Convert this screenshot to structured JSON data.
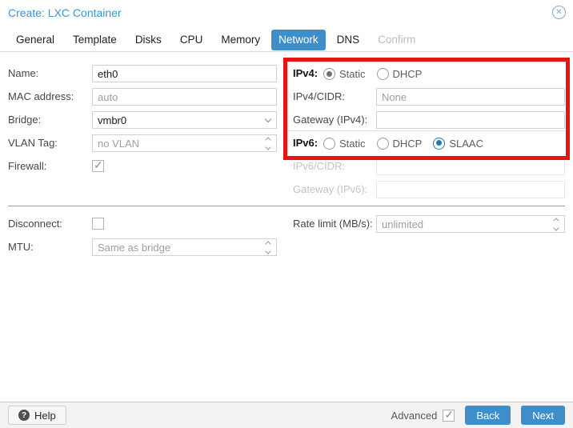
{
  "window": {
    "title": "Create: LXC Container"
  },
  "tabs": [
    {
      "label": "General",
      "active": false,
      "disabled": false
    },
    {
      "label": "Template",
      "active": false,
      "disabled": false
    },
    {
      "label": "Disks",
      "active": false,
      "disabled": false
    },
    {
      "label": "CPU",
      "active": false,
      "disabled": false
    },
    {
      "label": "Memory",
      "active": false,
      "disabled": false
    },
    {
      "label": "Network",
      "active": true,
      "disabled": false
    },
    {
      "label": "DNS",
      "active": false,
      "disabled": false
    },
    {
      "label": "Confirm",
      "active": false,
      "disabled": true
    }
  ],
  "form": {
    "name": {
      "label": "Name:",
      "value": "eth0"
    },
    "mac": {
      "label": "MAC address:",
      "placeholder": "auto"
    },
    "bridge": {
      "label": "Bridge:",
      "value": "vmbr0"
    },
    "vlan": {
      "label": "VLAN Tag:",
      "placeholder": "no VLAN"
    },
    "firewall": {
      "label": "Firewall:",
      "checked": true
    },
    "ipv4_mode": {
      "label": "IPv4:",
      "options": [
        "Static",
        "DHCP"
      ],
      "selected": "Static"
    },
    "ipv4_cidr": {
      "label": "IPv4/CIDR:",
      "placeholder": "None"
    },
    "gateway4": {
      "label": "Gateway (IPv4):",
      "value": ""
    },
    "ipv6_mode": {
      "label": "IPv6:",
      "options": [
        "Static",
        "DHCP",
        "SLAAC"
      ],
      "selected": "SLAAC"
    },
    "ipv6_cidr": {
      "label": "IPv6/CIDR:",
      "disabled": true
    },
    "gateway6": {
      "label": "Gateway (IPv6):",
      "disabled": true
    },
    "disconnect": {
      "label": "Disconnect:",
      "checked": false
    },
    "mtu": {
      "label": "MTU:",
      "placeholder": "Same as bridge"
    },
    "rate_limit": {
      "label": "Rate limit (MB/s):",
      "placeholder": "unlimited"
    }
  },
  "annotation": {
    "type": "red-highlight-box",
    "color": "#e81414",
    "highlights": "IPv4 and IPv6 mode settings"
  },
  "footer": {
    "help_label": "Help",
    "advanced_label": "Advanced",
    "advanced_checked": true,
    "back_label": "Back",
    "next_label": "Next"
  },
  "colors": {
    "accent_blue": "#3d8ec9",
    "title_blue": "#3c96d2",
    "highlight_red": "#e81414",
    "footer_bg": "#f3f3f3"
  }
}
